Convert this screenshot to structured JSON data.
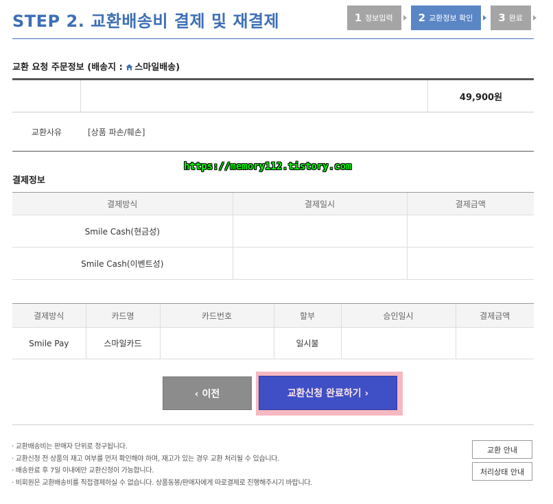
{
  "header": {
    "title": "STEP 2. 교환배송비 결제 및 재결제",
    "steps": [
      {
        "num": "1",
        "label": "정보입력"
      },
      {
        "num": "2",
        "label": "교환정보 확인"
      },
      {
        "num": "3",
        "label": "완료"
      }
    ]
  },
  "order": {
    "title": "교환 요청 주문정보 (배송지 :",
    "destination": "스마일배송",
    "close_paren": ")",
    "price": "49,900원",
    "reason_label": "교환사유",
    "reason_value": "[상품 파손/훼손]"
  },
  "watermark": "https://memory112.tistory.com",
  "payment": {
    "title": "결제정보",
    "columns": [
      "결제방식",
      "결제일시",
      "결제금액"
    ],
    "rows": [
      {
        "method": "Smile Cash(현금성)",
        "date": "",
        "amount": ""
      },
      {
        "method": "Smile Cash(이벤트성)",
        "date": "",
        "amount": ""
      }
    ]
  },
  "card": {
    "columns": [
      "결제방식",
      "카드명",
      "카드번호",
      "할부",
      "승인일시",
      "결제금액"
    ],
    "rows": [
      {
        "method": "Smile Pay",
        "card_name": "스마일카드",
        "card_no": "",
        "installment": "일시불",
        "approved": "",
        "amount": ""
      }
    ]
  },
  "buttons": {
    "prev": "‹ 이전",
    "complete": "교환신청 완료하기 ›",
    "exchange_guide": "교환 안내",
    "status_guide": "처리상태 안내"
  },
  "notes": [
    "교환배송비는 판매자 단위로 청구됩니다.",
    "교환신청 전 상품의 재고 여부를 먼저 확인해야 하며, 재고가 있는 경우 교환 처리될 수 있습니다.",
    "배송완료 후 7일 이내에만 교환신청이 가능합니다.",
    "비회원은 교환배송비를 직접결제하실 수 없습니다. 상품동봉/판매자에게 따로결제로 진행해주시기 바랍니다."
  ],
  "colors": {
    "accent": "#3d6fb5",
    "step_active": "#5b86c5",
    "step_inactive": "#a5a5a5",
    "complete_button": "#3f4fc5",
    "complete_highlight": "#f6b8c1",
    "prev_button": "#8c8c8c"
  },
  "icons": {
    "destination": "home-icon"
  }
}
